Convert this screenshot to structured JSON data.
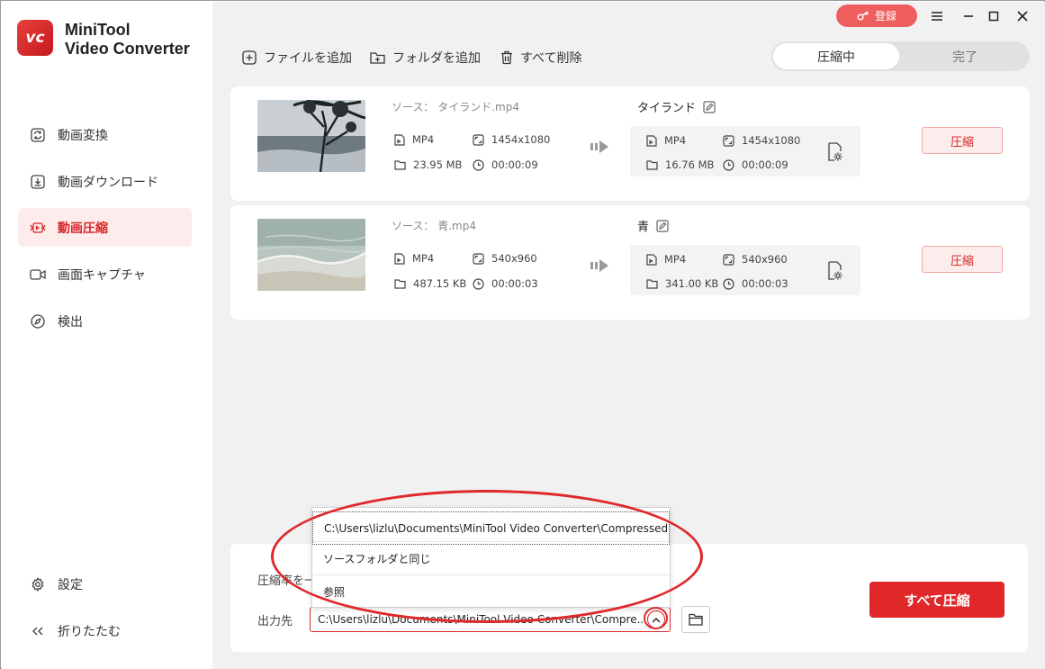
{
  "app": {
    "name_line1": "MiniTool",
    "name_line2": "Video Converter",
    "logo_text": "vc"
  },
  "sidebar": {
    "items": [
      {
        "label": "動画変換",
        "icon": "convert-icon",
        "active": false
      },
      {
        "label": "動画ダウンロード",
        "icon": "download-icon",
        "active": false
      },
      {
        "label": "動画圧縮",
        "icon": "compress-icon",
        "active": true
      },
      {
        "label": "画面キャプチャ",
        "icon": "camera-icon",
        "active": false
      },
      {
        "label": "検出",
        "icon": "compass-icon",
        "active": false
      }
    ],
    "settings_label": "設定",
    "collapse_label": "折りたたむ"
  },
  "window": {
    "register_label": "登録"
  },
  "toolbar": {
    "add_file": "ファイルを追加",
    "add_folder": "フォルダを追加",
    "delete_all": "すべて削除"
  },
  "tabs": {
    "compressing": "圧縮中",
    "done": "完了"
  },
  "items": [
    {
      "source_label": "ソース：",
      "source_file": "タイランド.mp4",
      "src": {
        "format": "MP4",
        "resolution": "1454x1080",
        "size": "23.95 MB",
        "duration": "00:00:09"
      },
      "output_name": "タイランド",
      "out": {
        "format": "MP4",
        "resolution": "1454x1080",
        "size": "16.76 MB",
        "duration": "00:00:09"
      },
      "compress_label": "圧縮"
    },
    {
      "source_label": "ソース：",
      "source_file": "青.mp4",
      "src": {
        "format": "MP4",
        "resolution": "540x960",
        "size": "487.15 KB",
        "duration": "00:00:03"
      },
      "output_name": "青",
      "out": {
        "format": "MP4",
        "resolution": "540x960",
        "size": "341.00 KB",
        "duration": "00:00:03"
      },
      "compress_label": "圧縮"
    }
  ],
  "bottom": {
    "ratio_label": "圧縮率を一",
    "output_label": "出力先",
    "output_path": "C:\\Users\\lizlu\\Documents\\MiniTool Video Converter\\Compre...",
    "compress_all": "すべて圧縮"
  },
  "dropdown": {
    "options": [
      "C:\\Users\\lizlu\\Documents\\MiniTool Video Converter\\Compressed",
      "ソースフォルダと同じ",
      "参照"
    ]
  },
  "colors": {
    "accent": "#e0282a",
    "accent_light": "#fdecec"
  }
}
